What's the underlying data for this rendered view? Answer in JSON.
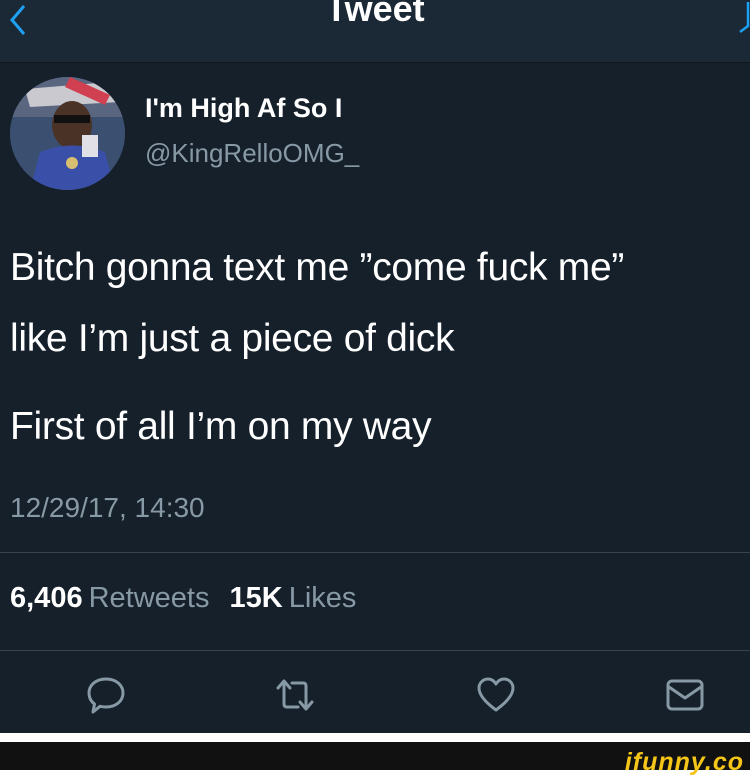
{
  "header": {
    "title": "Tweet"
  },
  "user": {
    "display_name": "I'm High Af So I",
    "handle": "@KingRelloOMG_"
  },
  "tweet": {
    "lines": [
      "Bitch gonna text me ”come fuck me”",
      "like I’m just a piece of dick",
      "First of all I’m on my way"
    ],
    "timestamp": "12/29/17, 14:30"
  },
  "stats": {
    "retweets_count": "6,406",
    "retweets_label": "Retweets",
    "likes_count": "15K",
    "likes_label": "Likes"
  },
  "actions": {
    "icons": [
      "reply-icon",
      "retweet-icon",
      "like-icon",
      "share-icon"
    ]
  },
  "watermark": "ifunny.co",
  "colors": {
    "background": "#15202b",
    "secondary_text": "#8899a6",
    "icon": "#8899a6",
    "watermark": "#f5c518"
  }
}
